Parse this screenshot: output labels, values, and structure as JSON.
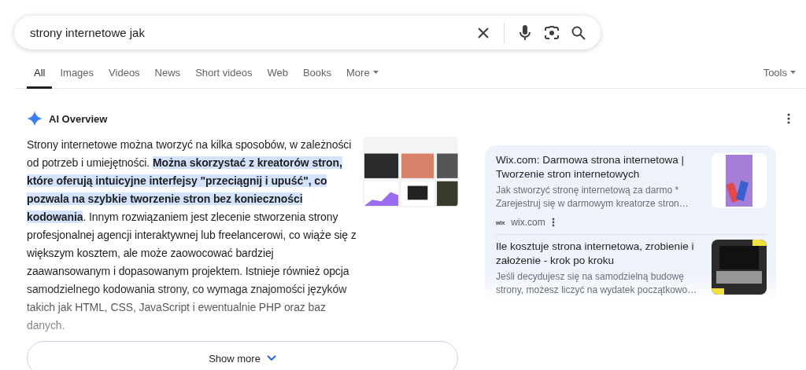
{
  "search": {
    "value": "strony internetowe jak"
  },
  "tabs": [
    {
      "label": "All",
      "selected": true
    },
    {
      "label": "Images",
      "selected": false
    },
    {
      "label": "Videos",
      "selected": false
    },
    {
      "label": "News",
      "selected": false
    },
    {
      "label": "Short videos",
      "selected": false
    },
    {
      "label": "Web",
      "selected": false
    },
    {
      "label": "Books",
      "selected": false
    },
    {
      "label": "More",
      "selected": false,
      "dropdown": true
    }
  ],
  "tools": {
    "label": "Tools"
  },
  "overview": {
    "title": "AI Overview",
    "text": "Strony internetowe można tworzyć na kilka sposobów, w zależności od potrzeb i umiejętności. **Można skorzystać z kreatorów stron, które oferują intuicyjne interfejsy \"przeciągnij i upuść\", co pozwala na szybkie tworzenie stron bez konieczności kodowania**. Innym rozwiązaniem jest zlecenie stworzenia strony profesjonalnej agencji interaktywnej lub freelancerowi, co wiąże się z większym kosztem, ale może zaowocować bardziej zaawansowanym i dopasowanym projektem. Istnieje również opcja samodzielnego kodowania strony, co wymaga znajomości języków takich jak HTML, CSS, JavaScript i ewentualnie PHP oraz baz danych.",
    "show_more": "Show more"
  },
  "sources": [
    {
      "title": "Wix.com: Darmowa strona internetowa | Tworzenie stron internetowych",
      "snippet": "Jak stworzyć stronę internetową za darmo * Zarejestruj się w darmowym kreatorze stron…",
      "site": "wix.com",
      "site_logo": "wix"
    },
    {
      "title": "Ile kosztuje strona internetowa, zrobienie i założenie - krok po kroku",
      "snippet": "Jeśli decydujesz się na samodzielną budowę strony, możesz liczyć na wydatek początkowo…"
    }
  ]
}
